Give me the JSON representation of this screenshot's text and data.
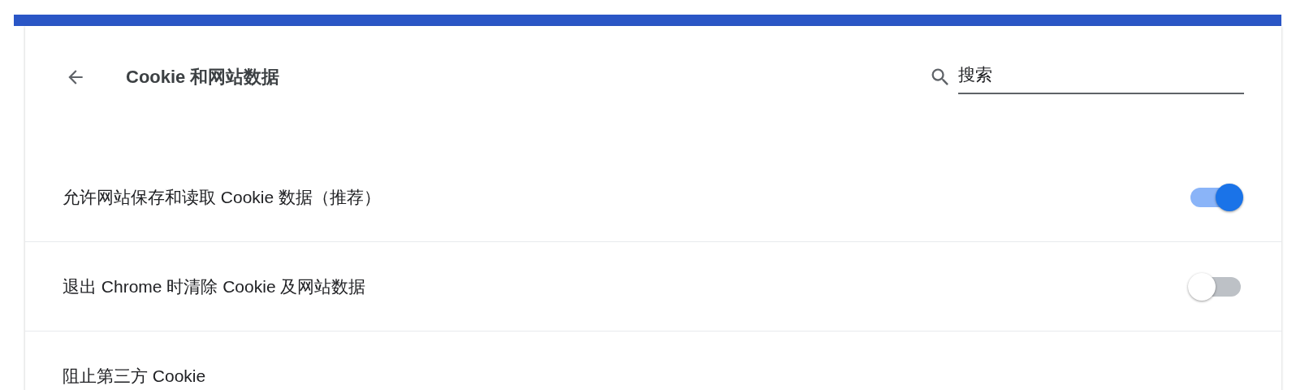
{
  "header": {
    "title": "Cookie 和网站数据",
    "search": {
      "placeholder": "搜索"
    }
  },
  "settings": [
    {
      "label": "允许网站保存和读取 Cookie 数据（推荐）",
      "on": true
    },
    {
      "label": "退出 Chrome 时清除 Cookie 及网站数据",
      "on": false
    },
    {
      "label": "阻止第三方 Cookie"
    }
  ]
}
